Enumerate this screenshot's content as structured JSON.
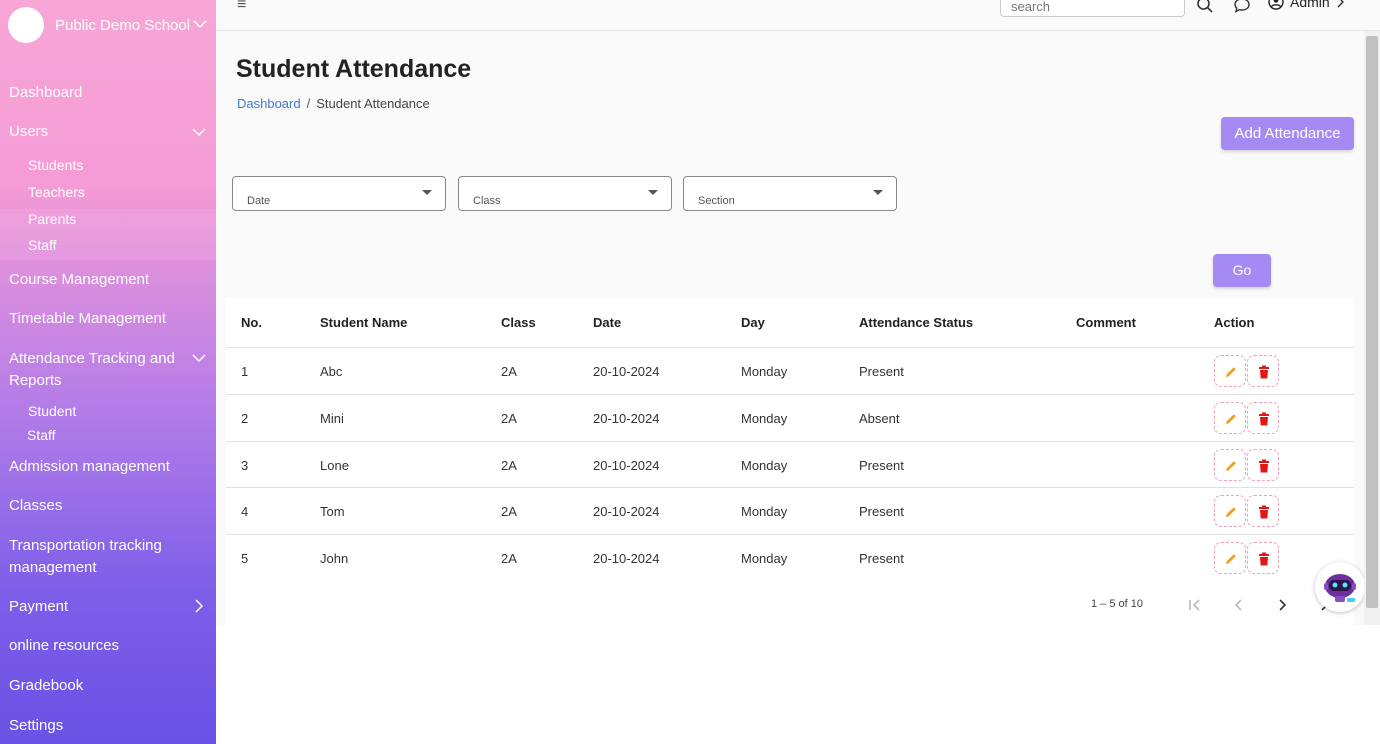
{
  "sidebar": {
    "brand": "Public Demo School",
    "items": {
      "dashboard": "Dashboard",
      "users": "Users",
      "students": "Students",
      "teachers": "Teachers",
      "parents": "Parents",
      "staff": "Staff",
      "course": "Course Management",
      "timetable": "Timetable Management",
      "attendance_l1": "Attendance Tracking and",
      "attendance_l2": "Reports",
      "att_student": "Student",
      "att_staff": "Staff",
      "admission": "Admission management",
      "classes": "Classes",
      "transport_l1": "Transportation tracking",
      "transport_l2": "management",
      "payment": "Payment",
      "online": "online resources",
      "gradebook": "Gradebook",
      "settings": "Settings"
    }
  },
  "topbar": {
    "search_placeholder": "search",
    "user": "Admin"
  },
  "page": {
    "title": "Student Attendance",
    "breadcrumb_link": "Dashboard",
    "breadcrumb_sep": "/",
    "breadcrumb_current": "Student Attendance",
    "add_button": "Add Attendance",
    "go_button": "Go"
  },
  "filters": {
    "date": "Date",
    "class": "Class",
    "section": "Section"
  },
  "table": {
    "headers": {
      "no": "No.",
      "name": "Student Name",
      "class": "Class",
      "date": "Date",
      "day": "Day",
      "status": "Attendance Status",
      "comment": "Comment",
      "action": "Action"
    },
    "rows": [
      {
        "no": "1",
        "name": "Abc",
        "class": "2A",
        "date": "20-10-2024",
        "day": "Monday",
        "status": "Present",
        "comment": ""
      },
      {
        "no": "2",
        "name": "Mini",
        "class": "2A",
        "date": "20-10-2024",
        "day": "Monday",
        "status": "Absent",
        "comment": ""
      },
      {
        "no": "3",
        "name": "Lone",
        "class": "2A",
        "date": "20-10-2024",
        "day": "Monday",
        "status": "Present",
        "comment": ""
      },
      {
        "no": "4",
        "name": "Tom",
        "class": "2A",
        "date": "20-10-2024",
        "day": "Monday",
        "status": "Present",
        "comment": ""
      },
      {
        "no": "5",
        "name": "John",
        "class": "2A",
        "date": "20-10-2024",
        "day": "Monday",
        "status": "Present",
        "comment": ""
      }
    ]
  },
  "pagination": {
    "range": "1 – 5 of 10"
  },
  "colors": {
    "accent": "#a58af4",
    "link": "#3f7ad4",
    "edit": "#f0a020",
    "delete": "#e01818"
  }
}
